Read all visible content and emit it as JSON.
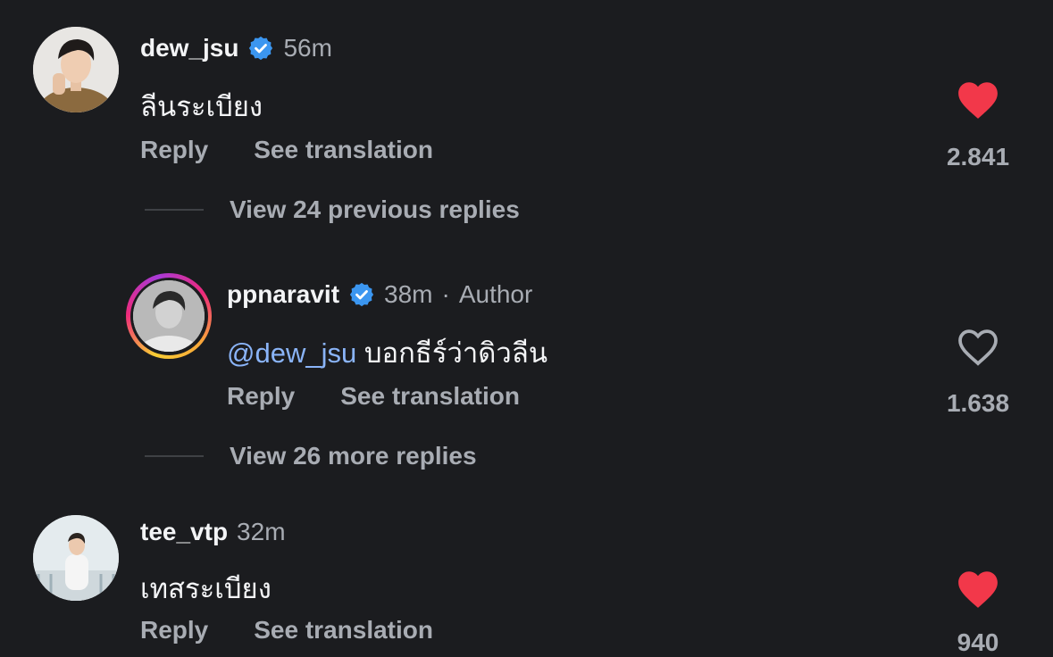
{
  "comments": [
    {
      "username": "dew_jsu",
      "verified": true,
      "time": "56m",
      "text": "ลีนระเบียง",
      "reply_label": "Reply",
      "translate_label": "See translation",
      "likes": "2.841",
      "liked": true
    },
    {
      "username": "ppnaravit",
      "verified": true,
      "time": "38m",
      "author_sep": "·",
      "author_label": "Author",
      "mention": "@dew_jsu",
      "text": "บอกธีร์ว่าดิวลีน",
      "reply_label": "Reply",
      "translate_label": "See translation",
      "likes": "1.638",
      "liked": false
    },
    {
      "username": "tee_vtp",
      "verified": false,
      "time": "32m",
      "text": "เทสระเบียง",
      "reply_label": "Reply",
      "translate_label": "See translation",
      "likes": "940",
      "liked": true
    }
  ],
  "view_previous": "View 24 previous replies",
  "view_more": "View 26 more replies",
  "colors": {
    "background": "#1b1c1f",
    "liked_heart": "#f2384a",
    "mention": "#8ab4f8",
    "verified": "#3b96f0",
    "muted_text": "#a8acb3"
  },
  "icons": [
    "verified-badge-icon",
    "heart-filled-icon",
    "heart-outline-icon"
  ]
}
